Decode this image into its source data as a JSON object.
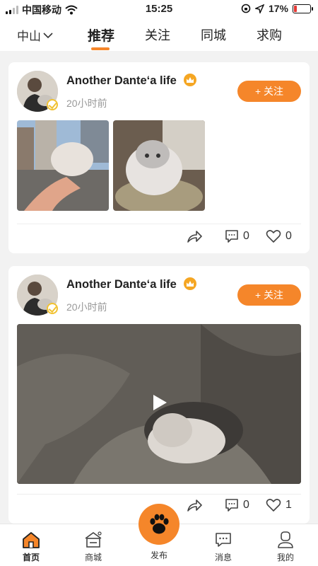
{
  "status_bar": {
    "carrier": "中国移动",
    "time": "15:25",
    "battery": "17%",
    "battery_level": 0.17
  },
  "top_nav": {
    "city": "中山",
    "tabs": [
      {
        "label": "推荐",
        "active": true
      },
      {
        "label": "关注",
        "active": false
      },
      {
        "label": "同城",
        "active": false
      },
      {
        "label": "求购",
        "active": false
      }
    ]
  },
  "posts": [
    {
      "username": "Another Dante‘a life",
      "time": "20小时前",
      "follow_label": "+ 关注",
      "media": [
        "photo",
        "photo"
      ],
      "comments": "0",
      "likes": "0"
    },
    {
      "username": "Another Dante‘a life",
      "time": "20小时前",
      "follow_label": "+ 关注",
      "media": [
        "video"
      ],
      "comments": "0",
      "likes": "1"
    }
  ],
  "bottom_nav": [
    {
      "label": "首页",
      "icon": "home-icon",
      "active": true
    },
    {
      "label": "商城",
      "icon": "shop-icon",
      "active": false
    },
    {
      "label": "发布",
      "icon": "paw-icon",
      "active": false
    },
    {
      "label": "消息",
      "icon": "message-icon",
      "active": false
    },
    {
      "label": "我的",
      "icon": "profile-icon",
      "active": false
    }
  ],
  "colors": {
    "accent": "#f5862a",
    "badge": "#f1c232",
    "crown": "#f5a623"
  }
}
